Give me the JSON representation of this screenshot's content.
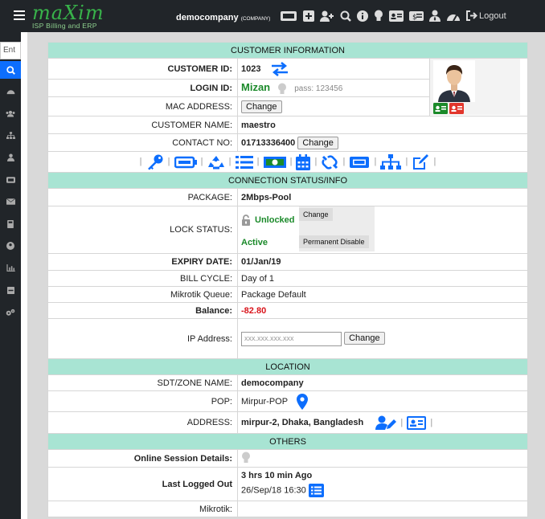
{
  "header": {
    "logo_text": "maXim",
    "logo_tagline": "ISP Billing and ERP",
    "company_name": "democompany",
    "company_tag": "(COMPANY)",
    "logout_label": "Logout",
    "icons": [
      "ticket-icon",
      "plus-square-icon",
      "add-user-icon",
      "search-icon",
      "info-icon",
      "bulb-icon",
      "id-card-icon",
      "money-icon",
      "user-tie-icon",
      "dashboard-icon",
      "sign-out-icon"
    ]
  },
  "sidebar": {
    "input_value": "Ent",
    "items": [
      "search-icon",
      "dashboard-icon",
      "users-icon",
      "sitemap-icon",
      "user-icon",
      "ticket-icon",
      "envelope-icon",
      "calculator-icon",
      "user-circle-icon",
      "chart-icon",
      "server-icon",
      "cogs-icon"
    ]
  },
  "customer": {
    "section_title": "CUSTOMER INFORMATION",
    "id_label": "CUSTOMER ID:",
    "id_value": "1023",
    "login_label": "LOGIN ID:",
    "login_value": "Mizan",
    "pass_text": "pass: 123456",
    "mac_label": "MAC ADDRESS:",
    "change_label": "Change",
    "name_label": "CUSTOMER NAME:",
    "name_value": "maestro",
    "contact_label": "CONTACT NO:",
    "contact_value": "01713336400"
  },
  "connection": {
    "section_title": "CONNECTION STATUS/INFO",
    "package_label": "PACKAGE:",
    "package_value": "2Mbps-Pool",
    "lock_label": "LOCK STATUS:",
    "lock_value": "Unlocked",
    "lock_change": "Change",
    "active_value": "Active",
    "permanent_disable": "Permanent Disable",
    "expiry_label": "EXPIRY DATE:",
    "expiry_value": "01/Jan/19",
    "bill_label": "BILL CYCLE:",
    "bill_value": "Day of 1",
    "queue_label": "Mikrotik Queue:",
    "queue_value": "Package Default",
    "balance_label": "Balance:",
    "balance_value": "-82.80",
    "ip_label": "IP Address:",
    "ip_placeholder": "xxx.xxx.xxx.xxx",
    "ip_change": "Change"
  },
  "location": {
    "section_title": "LOCATION",
    "zone_label": "SDT/ZONE NAME:",
    "zone_value": "democompany",
    "pop_label": "POP:",
    "pop_value": "Mirpur-POP",
    "address_label": "ADDRESS:",
    "address_value": "mirpur-2, Dhaka, Bangladesh"
  },
  "others": {
    "section_title": "OTHERS",
    "session_label": "Online Session Details:",
    "last_logged_label": "Last Logged Out",
    "last_logged_ago": "3 hrs 10 min Ago",
    "last_logged_time": "26/Sep/18 16:30",
    "mikrotik_label": "Mikrotik:"
  },
  "colors": {
    "topbar": "#212529",
    "accent": "#0d6efd",
    "section_header": "#a8e4d3",
    "green": "#1b8a2a",
    "red": "#d9141b"
  }
}
